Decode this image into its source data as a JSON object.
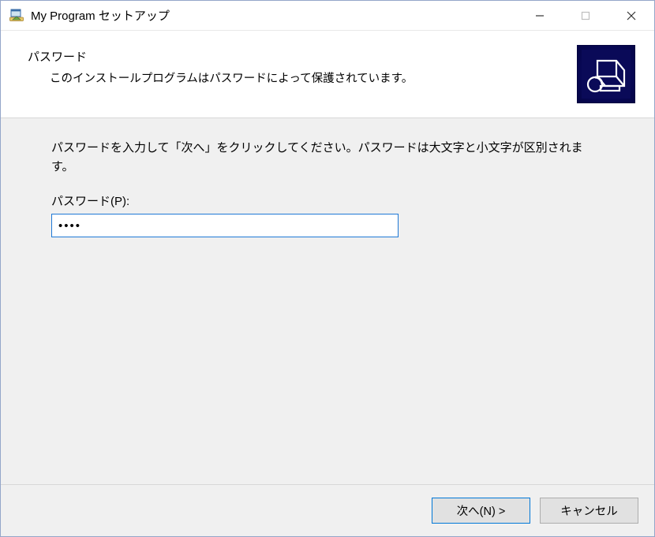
{
  "window": {
    "title": "My Program セットアップ"
  },
  "header": {
    "title": "パスワード",
    "subtitle": "このインストールプログラムはパスワードによって保護されています。"
  },
  "body": {
    "instruction": "パスワードを入力して「次へ」をクリックしてください。パスワードは大文字と小文字が区別されます。",
    "password_label": "パスワード(P):",
    "password_value": "••••"
  },
  "footer": {
    "next_label": "次へ(N) >",
    "cancel_label": "キャンセル"
  }
}
